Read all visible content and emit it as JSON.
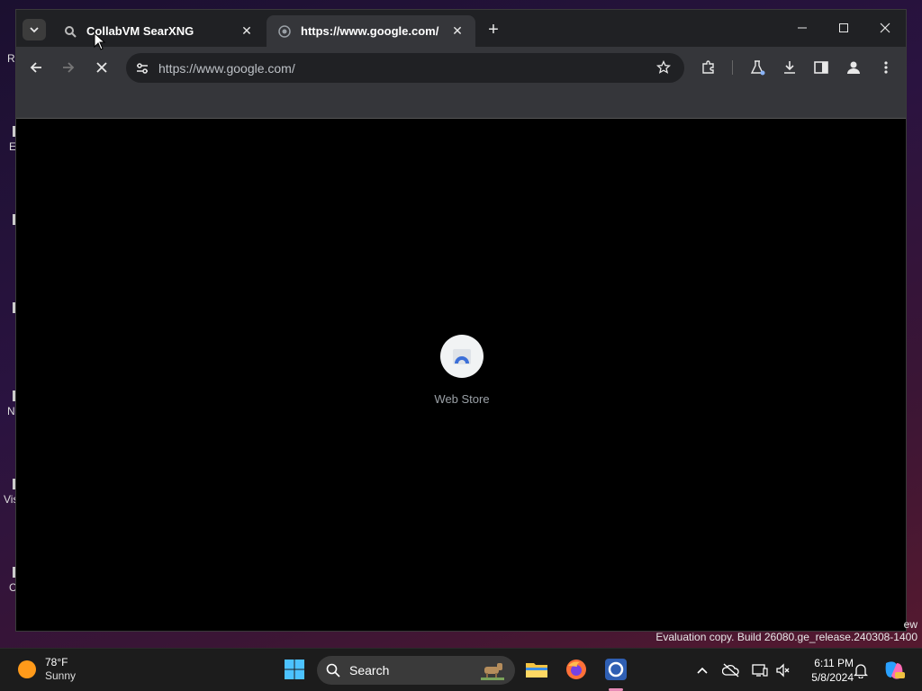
{
  "browser": {
    "tabs": [
      {
        "title": "CollabVM SearXNG",
        "active": false
      },
      {
        "title": "https://www.google.com/",
        "active": true
      }
    ],
    "address_bar": {
      "value": "https://www.google.com/"
    },
    "content": {
      "shortcut_label": "Web Store"
    }
  },
  "watermark": {
    "partial": "ew",
    "text": "Evaluation copy. Build 26080.ge_release.240308-1400"
  },
  "taskbar": {
    "weather_temp": "78°F",
    "weather_condition": "Sunny",
    "search_label": "Search",
    "time": "6:11 PM",
    "date": "5/8/2024"
  },
  "desktop_fragments": [
    "R",
    "E",
    "N",
    "Vis",
    "C"
  ],
  "colors": {
    "tabstrip": "#202124",
    "toolbar": "#35363a",
    "page_background": "#000000",
    "taskbar": "#1c1c1c"
  }
}
